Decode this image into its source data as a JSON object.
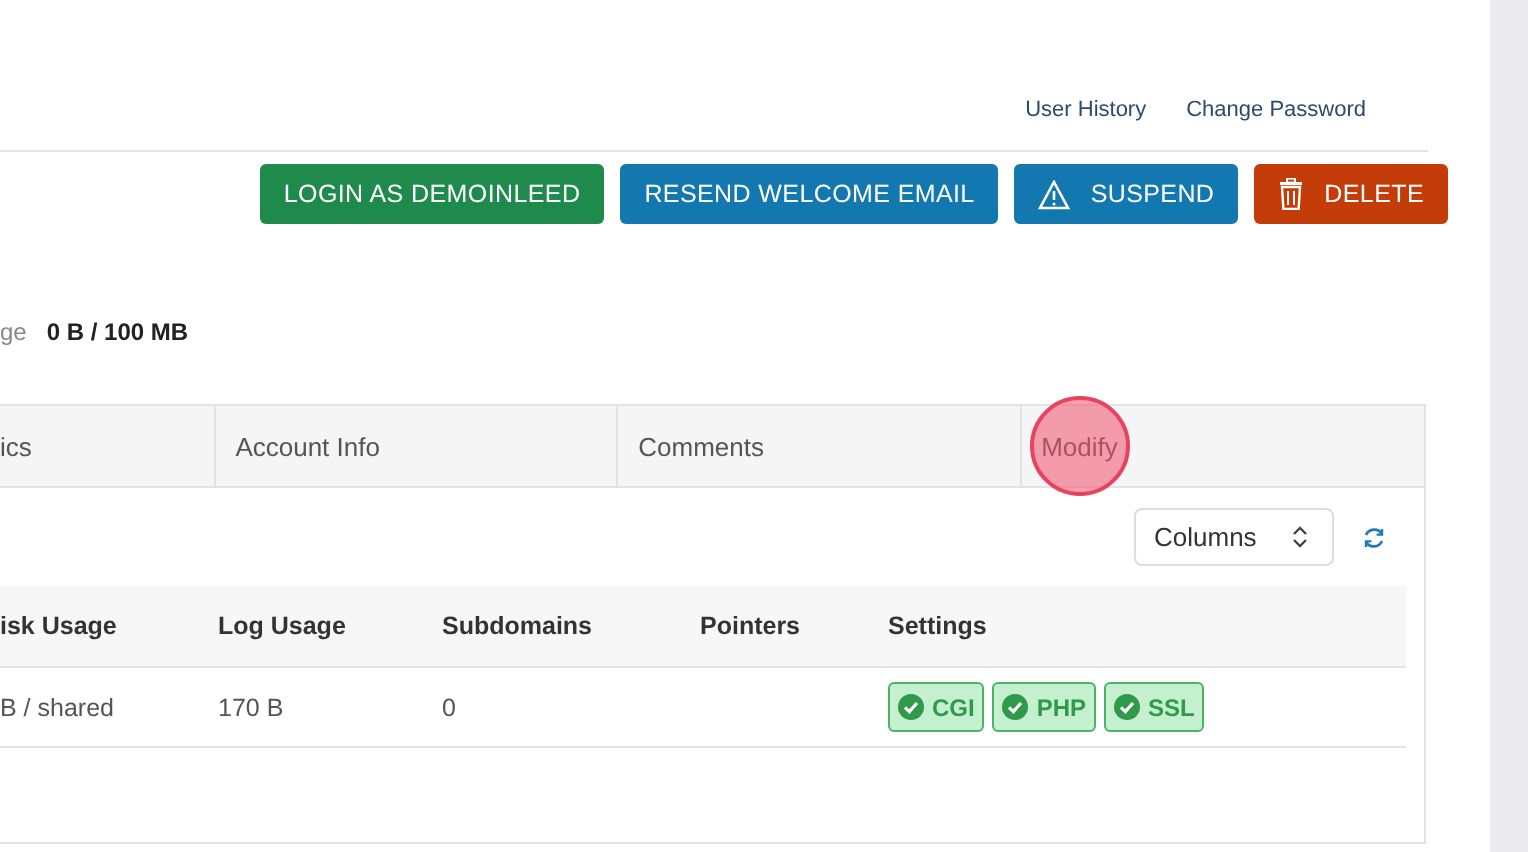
{
  "header_links": [
    "User History",
    "Change Password"
  ],
  "actions": [
    {
      "label": "LOGIN AS DEMOINLEED",
      "kind": "login"
    },
    {
      "label": "RESEND WELCOME EMAIL",
      "kind": "resend"
    },
    {
      "label": "SUSPEND",
      "kind": "suspend"
    },
    {
      "label": "DELETE",
      "kind": "delete"
    }
  ],
  "storage": {
    "label": "ge",
    "value": "0 B / 100 MB"
  },
  "tabs": [
    {
      "label": "ics",
      "selected": false
    },
    {
      "label": "Account Info",
      "selected": false
    },
    {
      "label": "Comments",
      "selected": false
    },
    {
      "label": "Modify",
      "selected": false
    }
  ],
  "columns_select": {
    "value": "Columns"
  },
  "table": {
    "columns": [
      "isk Usage",
      "Log Usage",
      "Subdomains",
      "Pointers",
      "Settings"
    ],
    "rows": [
      {
        "cells": [
          "B / shared",
          "170 B",
          "0",
          ""
        ],
        "settings": [
          "CGI",
          "PHP",
          "SSL"
        ]
      }
    ]
  },
  "click_marker": {
    "on": true
  }
}
